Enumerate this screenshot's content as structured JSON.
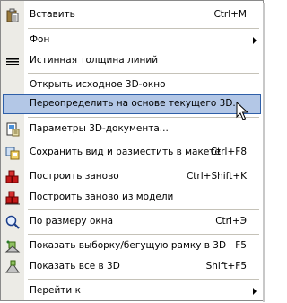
{
  "menu": {
    "items": [
      {
        "label": "Вставить",
        "shortcut": "Ctrl+M",
        "icon": "paste-icon"
      },
      {
        "label": "Фон",
        "shortcut": "",
        "icon": "",
        "submenu": true
      },
      {
        "label": "Истинная толщина линий",
        "shortcut": "",
        "icon": "line-weight-icon"
      },
      {
        "label": "Открыть исходное 3D-окно",
        "shortcut": "",
        "icon": ""
      },
      {
        "label": "Переопределить на основе текущего 3D...",
        "shortcut": "",
        "icon": "",
        "highlighted": true
      },
      {
        "label": "Параметры 3D-документа...",
        "shortcut": "",
        "icon": "document-settings-icon"
      },
      {
        "label": "Сохранить вид и разместить в макете",
        "shortcut": "Ctrl+F8",
        "icon": "save-view-icon"
      },
      {
        "label": "Построить заново",
        "shortcut": "Ctrl+Shift+K",
        "icon": "rebuild-icon"
      },
      {
        "label": "Построить заново из модели",
        "shortcut": "",
        "icon": "rebuild-from-model-icon"
      },
      {
        "label": "По размеру окна",
        "shortcut": "Ctrl+Э",
        "icon": "fit-window-icon"
      },
      {
        "label": "Показать выборку/бегущую рамку в 3D",
        "shortcut": "F5",
        "icon": "show-selection-3d-icon"
      },
      {
        "label": "Показать все в 3D",
        "shortcut": "Shift+F5",
        "icon": "show-all-3d-icon"
      },
      {
        "label": "Перейти к",
        "shortcut": "",
        "icon": "",
        "submenu": true
      }
    ]
  },
  "colors": {
    "highlight_bg": "#b3c7e6",
    "highlight_border": "#2f5fa8",
    "gutter": "#ecebe6"
  }
}
